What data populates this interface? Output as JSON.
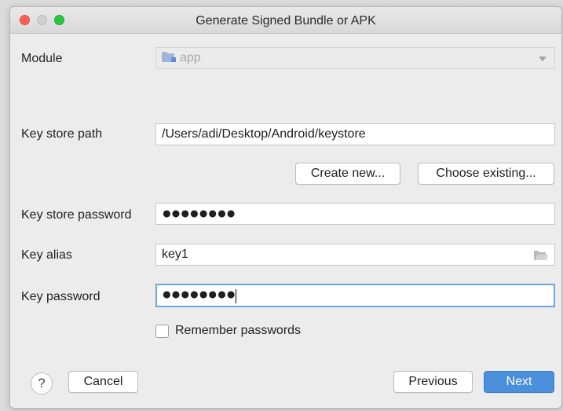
{
  "window": {
    "title": "Generate Signed Bundle or APK"
  },
  "form": {
    "module": {
      "label": "Module",
      "value": "app",
      "icon": "module-folder-icon"
    },
    "key_store_path": {
      "label": "Key store path",
      "value": "/Users/adi/Desktop/Android/keystore"
    },
    "create_new_label": "Create new...",
    "choose_existing_label": "Choose existing...",
    "key_store_password": {
      "label": "Key store password",
      "masked_value": "●●●●●●●●"
    },
    "key_alias": {
      "label": "Key alias",
      "value": "key1",
      "icon": "folder-icon"
    },
    "key_password": {
      "label": "Key password",
      "masked_value": "●●●●●●●●"
    },
    "remember_passwords": {
      "label": "Remember passwords",
      "checked": false
    }
  },
  "footer": {
    "help_label": "?",
    "cancel_label": "Cancel",
    "previous_label": "Previous",
    "next_label": "Next"
  },
  "colors": {
    "primary_button": "#4a8fdc",
    "focus_ring": "#6ea4e6",
    "close_light": "#fc5f57",
    "zoom_light": "#2ac641"
  }
}
